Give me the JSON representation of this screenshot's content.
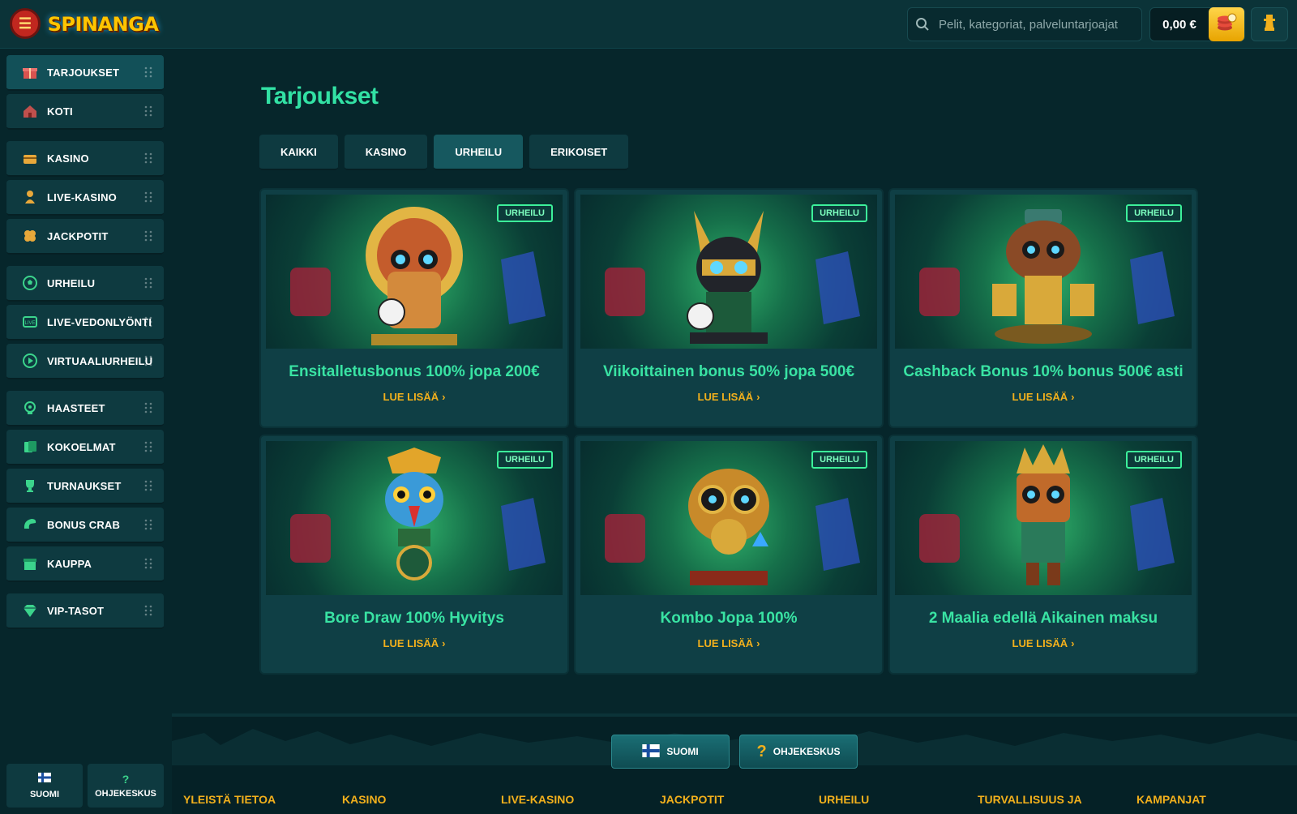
{
  "header": {
    "logo_text": "SPINANGA",
    "search_placeholder": "Pelit, kategoriat, palveluntarjoajat",
    "balance": "0,00 €"
  },
  "sidebar": {
    "items": [
      {
        "label": "TARJOUKSET",
        "icon": "gift-icon"
      },
      {
        "label": "KOTI",
        "icon": "home-icon"
      },
      {
        "label": "KASINO",
        "icon": "casino-chest-icon"
      },
      {
        "label": "LIVE-KASINO",
        "icon": "live-dealer-icon"
      },
      {
        "label": "JACKPOTIT",
        "icon": "clover-icon"
      },
      {
        "label": "URHEILU",
        "icon": "soccer-ball-icon"
      },
      {
        "label": "LIVE-VEDONLYÖNTI",
        "icon": "live-tv-icon"
      },
      {
        "label": "VIRTUAALIURHEILU",
        "icon": "play-circle-icon"
      },
      {
        "label": "HAASTEET",
        "icon": "challenge-icon"
      },
      {
        "label": "KOKOELMAT",
        "icon": "cards-icon"
      },
      {
        "label": "TURNAUKSET",
        "icon": "trophy-icon"
      },
      {
        "label": "BONUS CRAB",
        "icon": "crab-claw-icon"
      },
      {
        "label": "KAUPPA",
        "icon": "shop-icon"
      },
      {
        "label": "VIP-TASOT",
        "icon": "diamond-icon"
      }
    ],
    "bottom": {
      "language": "SUOMI",
      "help": "OHJEKESKUS"
    }
  },
  "main": {
    "title": "Tarjoukset",
    "tabs": [
      "KAIKKI",
      "KASINO",
      "URHEILU",
      "ERIKOISET"
    ],
    "active_tab": "URHEILU",
    "read_more": "LUE LISÄÄ",
    "cards": [
      {
        "badge": "URHEILU",
        "title": "Ensitalletusbonus 100% jopa 200€",
        "mascot": "tiki-mask-with-ball"
      },
      {
        "badge": "URHEILU",
        "title": "Viikoittainen bonus 50% jopa 500€",
        "mascot": "tiki-dog-with-ball"
      },
      {
        "badge": "URHEILU",
        "title": "Cashback Bonus 10% bonus 500€ asti",
        "mascot": "tiki-monkey"
      },
      {
        "badge": "URHEILU",
        "title": "Bore Draw 100% Hyvitys",
        "mascot": "tiki-parrot-totem"
      },
      {
        "badge": "URHEILU",
        "title": "Kombo Jopa 100%",
        "mascot": "tiki-owl"
      },
      {
        "badge": "URHEILU",
        "title": "2 Maalia edellä Aikainen maksu",
        "mascot": "tiki-warrior"
      }
    ]
  },
  "footer": {
    "language_button": "SUOMI",
    "help_button": "OHJEKESKUS",
    "links": [
      "YLEISTÄ TIETOA",
      "KASINO",
      "LIVE-KASINO",
      "JACKPOTIT",
      "URHEILU",
      "TURVALLISUUS JA YKSITYISYYS",
      "KAMPANJAT"
    ]
  },
  "colors": {
    "accent_green": "#32e1a4",
    "accent_gold": "#f2b01c",
    "background": "#06262b",
    "panel": "#0e3a40"
  }
}
